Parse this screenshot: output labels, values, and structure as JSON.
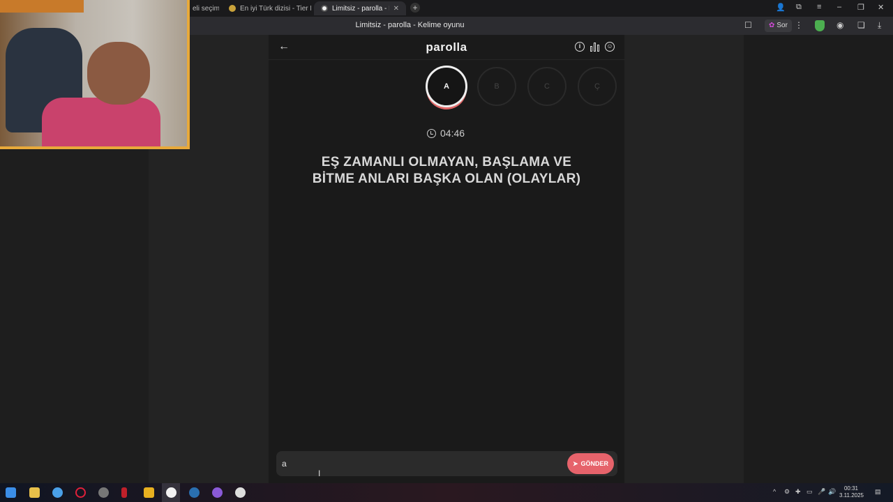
{
  "browser": {
    "tabs": [
      {
        "label": "eli seçimi"
      },
      {
        "label": "En iyi Türk dizisi - Tier List"
      },
      {
        "label": "Limitsiz - parolla - Kelim"
      }
    ],
    "window_title": "Limitsiz - parolla - Kelime oyunu",
    "ask_label": "Sor"
  },
  "page": {
    "brand": "parolla",
    "letters": [
      "A",
      "B",
      "C",
      "Ç"
    ],
    "active_letter": "A",
    "timer": "04:46",
    "question_line1": "EŞ ZAMANLI OLMAYAN, BAŞLAMA VE",
    "question_line2": "BİTME ANLARI BAŞKA OLAN (OLAYLAR)",
    "answer_value": "a",
    "send_label": "GÖNDER"
  },
  "taskbar": {
    "time": "00:31",
    "date": "3.11.2025"
  },
  "colors": {
    "accent": "#e6636b",
    "webcam_frame": "#e8a93a"
  }
}
